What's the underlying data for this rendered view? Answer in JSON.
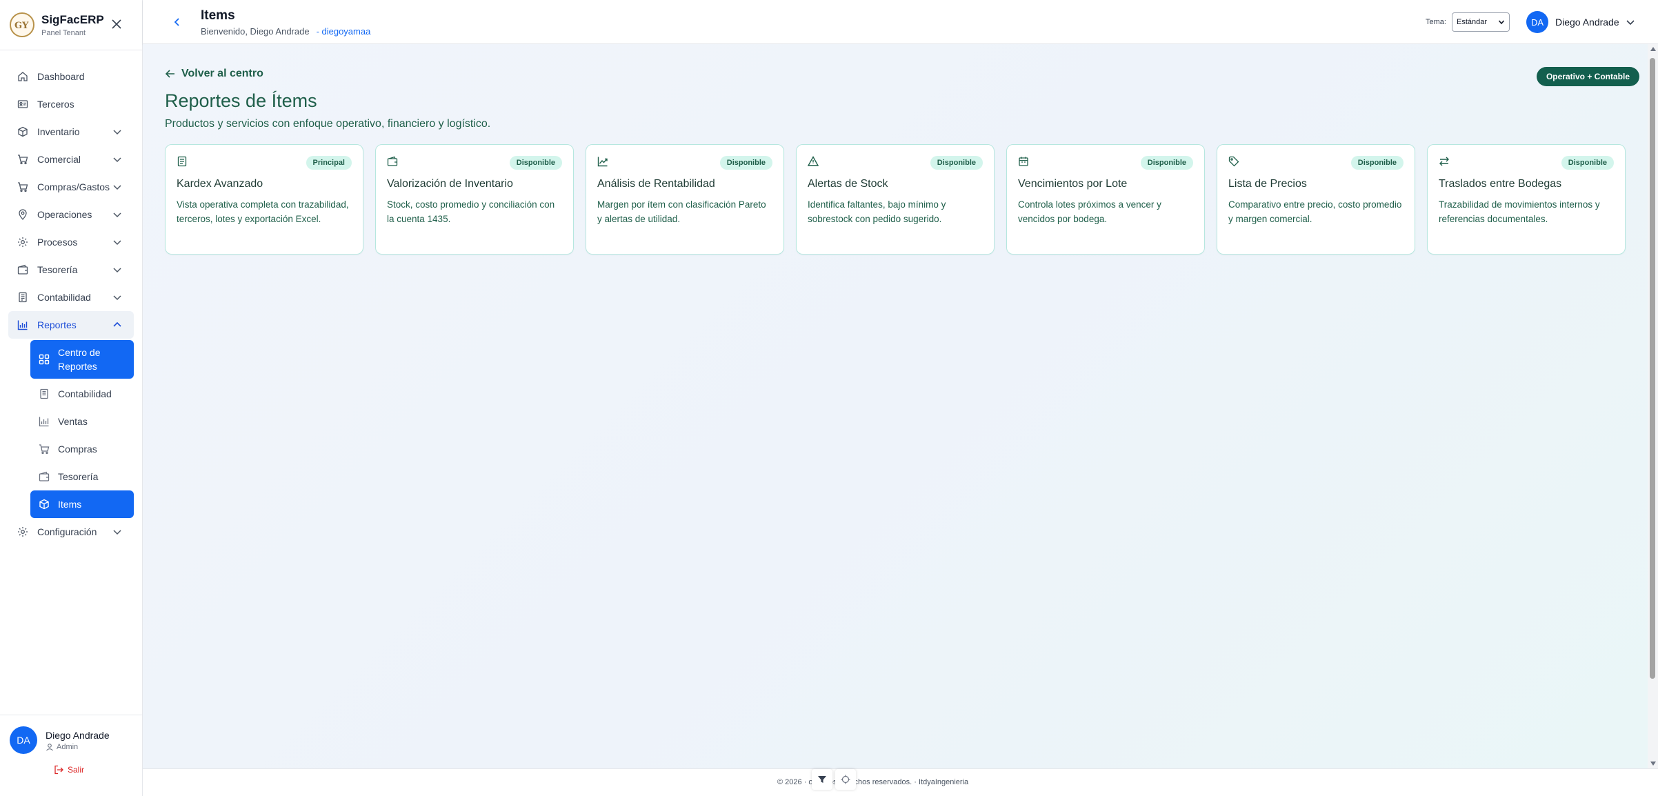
{
  "brand": {
    "name": "SigFacERP",
    "subtitle": "Panel Tenant",
    "logo_text": "GY"
  },
  "sidebar": {
    "items": [
      {
        "label": "Dashboard",
        "icon": "home-icon"
      },
      {
        "label": "Terceros",
        "icon": "id-card-icon"
      },
      {
        "label": "Inventario",
        "icon": "box-icon"
      },
      {
        "label": "Comercial",
        "icon": "cart-icon"
      },
      {
        "label": "Compras/Gastos",
        "icon": "bag-icon"
      },
      {
        "label": "Operaciones",
        "icon": "pin-icon"
      },
      {
        "label": "Procesos",
        "icon": "gear-icon"
      },
      {
        "label": "Tesorería",
        "icon": "wallet-icon"
      },
      {
        "label": "Contabilidad",
        "icon": "ledger-icon"
      },
      {
        "label": "Reportes",
        "icon": "chart-icon"
      },
      {
        "label": "Configuración",
        "icon": "gear-icon"
      }
    ],
    "reportes_sub": [
      {
        "label": "Centro de Reportes",
        "icon": "grid-icon"
      },
      {
        "label": "Contabilidad",
        "icon": "ledger-icon"
      },
      {
        "label": "Ventas",
        "icon": "chart-icon"
      },
      {
        "label": "Compras",
        "icon": "cart-icon"
      },
      {
        "label": "Tesorería",
        "icon": "wallet-icon"
      },
      {
        "label": "Items",
        "icon": "box-icon"
      }
    ],
    "user": {
      "initials": "DA",
      "name": "Diego Andrade",
      "role": "Admin",
      "logout": "Salir"
    }
  },
  "header": {
    "title": "Items",
    "welcome": "Bienvenido, Diego Andrade",
    "username": "- diegoyamaa",
    "theme_label": "Tema:",
    "theme_value": "Estándar",
    "user_initials": "DA",
    "user_name": "Diego Andrade"
  },
  "main": {
    "back_label": "Volver al centro",
    "mode_badge": "Operativo + Contable",
    "title": "Reportes de Ítems",
    "subtitle": "Productos y servicios con enfoque operativo, financiero y logístico.",
    "cards": [
      {
        "icon": "document-icon",
        "badge": "Principal",
        "title": "Kardex Avanzado",
        "desc": "Vista operativa completa con trazabilidad, terceros, lotes y exportación Excel."
      },
      {
        "icon": "wallet-icon",
        "badge": "Disponible",
        "title": "Valorización de Inventario",
        "desc": "Stock, costo promedio y conciliación con la cuenta 1435."
      },
      {
        "icon": "trend-up-icon",
        "badge": "Disponible",
        "title": "Análisis de Rentabilidad",
        "desc": "Margen por ítem con clasificación Pareto y alertas de utilidad."
      },
      {
        "icon": "warning-icon",
        "badge": "Disponible",
        "title": "Alertas de Stock",
        "desc": "Identifica faltantes, bajo mínimo y sobrestock con pedido sugerido."
      },
      {
        "icon": "calendar-icon",
        "badge": "Disponible",
        "title": "Vencimientos por Lote",
        "desc": "Controla lotes próximos a vencer y vencidos por bodega."
      },
      {
        "icon": "tag-icon",
        "badge": "Disponible",
        "title": "Lista de Precios",
        "desc": "Comparativo entre precio, costo promedio y margen comercial."
      },
      {
        "icon": "transfer-icon",
        "badge": "Disponible",
        "title": "Traslados entre Bodegas",
        "desc": "Trazabilidad de movimientos internos y referencias documentales."
      }
    ]
  },
  "footer": {
    "text": "© 2026 ·                  odos los derechos reservados. · ItdyaIngenieria"
  },
  "colors": {
    "primary": "#1268f3",
    "teal_dark": "#135f4e",
    "teal_text": "#1f5f4a",
    "badge_bg": "#d3f5ec",
    "card_border": "#b6e7df"
  }
}
